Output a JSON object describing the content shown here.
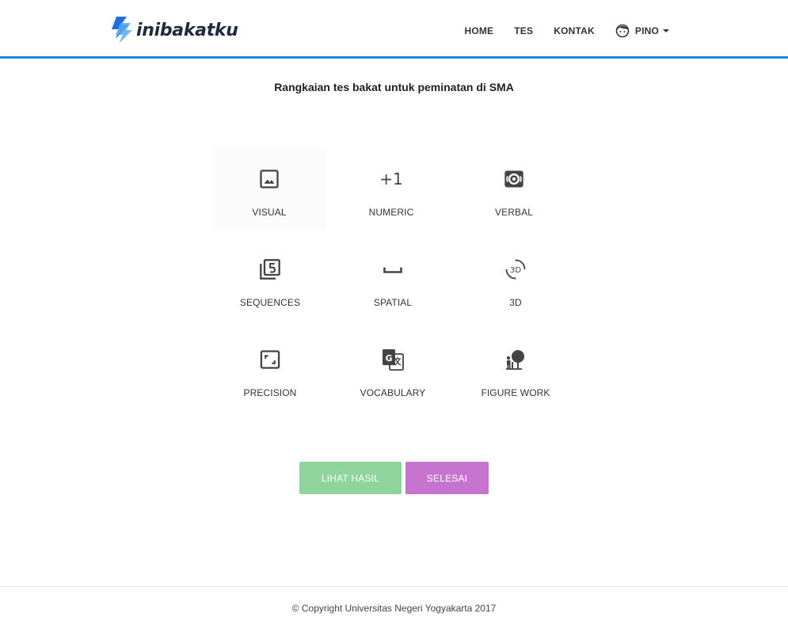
{
  "brand": {
    "name": "inibakatku",
    "accent": "#1e88e5"
  },
  "nav": {
    "items": [
      "HOME",
      "TES",
      "KONTAK"
    ],
    "user": {
      "name": "PINO",
      "icon": "face-icon"
    }
  },
  "main": {
    "title": "Rangkaian tes bakat untuk peminatan di SMA",
    "tests": [
      {
        "label": "VISUAL",
        "icon": "image-icon"
      },
      {
        "label": "NUMERIC",
        "icon": "plus-one-icon",
        "glyph": "+1"
      },
      {
        "label": "VERBAL",
        "icon": "voice-icon"
      },
      {
        "label": "SEQUENCES",
        "icon": "filter-5-icon"
      },
      {
        "label": "SPATIAL",
        "icon": "space-bar-icon"
      },
      {
        "label": "3D",
        "icon": "3d-rotation-icon"
      },
      {
        "label": "PRECISION",
        "icon": "crop-free-icon"
      },
      {
        "label": "VOCABULARY",
        "icon": "translate-icon"
      },
      {
        "label": "FIGURE WORK",
        "icon": "nature-people-icon"
      }
    ],
    "buttons": {
      "results_label": "LIHAT HASIL",
      "results_color": "#8fd49b",
      "finish_label": "SELESAI",
      "finish_color": "#c774d1"
    }
  },
  "footer": {
    "text": "© Copyright Universitas Negeri Yogyakarta 2017"
  }
}
